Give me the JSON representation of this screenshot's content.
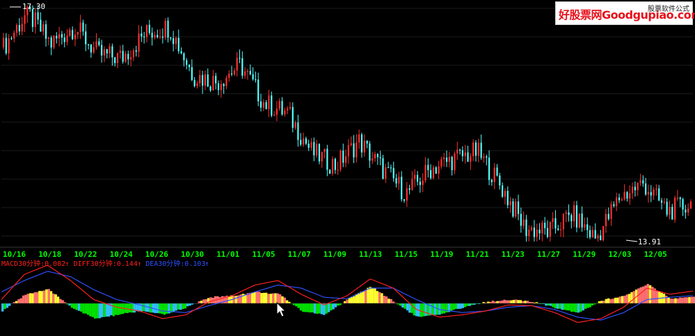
{
  "chart_data": [
    {
      "type": "line",
      "title": "",
      "x": [
        "10/16",
        "10/18",
        "10/22",
        "10/24",
        "10/26",
        "10/30",
        "11/01",
        "11/05",
        "11/07",
        "11/09",
        "11/13",
        "11/15",
        "11/19",
        "11/21",
        "11/23",
        "11/27",
        "11/29",
        "12/03",
        "12/05"
      ],
      "series": [
        {
          "values": [
            16.7,
            17.2,
            16.75,
            17.0,
            16.6,
            16.55,
            16.9,
            17.0,
            16.3,
            16.2,
            16.45,
            15.9,
            15.75,
            15.2,
            15.0,
            15.35,
            14.95,
            14.6,
            14.95,
            15.1,
            15.2,
            14.7,
            14.1,
            14.05,
            14.3,
            13.95,
            14.55,
            14.75,
            14.35,
            14.45
          ]
        }
      ],
      "annotations": {
        "high_label": "17.30",
        "low_label": "13.91"
      },
      "x_tick_color": "#00ff00",
      "colors": {
        "up_bar": "#ff3030",
        "down_bar": "#54ffff",
        "background": "#000000"
      }
    },
    {
      "type": "bar",
      "title": "MACD",
      "legend": [
        {
          "text": "MACD30分钟:0.082",
          "color": "#ff2020"
        },
        {
          "text": "DIFF30分钟:0.144",
          "color": "#ff2020"
        },
        {
          "text": "DEA30分钟:0.103",
          "color": "#3050ff"
        }
      ],
      "series": [
        {
          "name": "DIFF30分钟",
          "color": "#ff2020",
          "values": [
            0.05,
            0.38,
            0.5,
            0.3,
            0.05,
            -0.05,
            -0.1,
            -0.2,
            -0.15,
            0.02,
            0.1,
            0.24,
            0.3,
            0.12,
            -0.02,
            0.1,
            0.32,
            0.2,
            -0.08,
            -0.18,
            -0.15,
            -0.1,
            -0.02,
            -0.03,
            -0.12,
            -0.25,
            -0.2,
            -0.05,
            0.2,
            0.12,
            0.16
          ]
        },
        {
          "name": "DEA30分钟",
          "color": "#3050ff",
          "values": [
            0.15,
            0.3,
            0.42,
            0.35,
            0.18,
            0.05,
            -0.02,
            -0.1,
            -0.12,
            -0.03,
            0.05,
            0.15,
            0.24,
            0.2,
            0.08,
            0.06,
            0.2,
            0.2,
            0.05,
            -0.08,
            -0.12,
            -0.1,
            -0.05,
            -0.03,
            -0.08,
            -0.18,
            -0.22,
            -0.12,
            0.05,
            0.08,
            0.1
          ]
        },
        {
          "name": "MACD30分钟",
          "values": [
            -0.1,
            0.12,
            0.18,
            -0.05,
            -0.2,
            -0.15,
            -0.1,
            -0.15,
            -0.05,
            0.08,
            0.1,
            0.15,
            0.12,
            -0.1,
            -0.15,
            0.06,
            0.22,
            0.02,
            -0.18,
            -0.15,
            -0.05,
            0.02,
            0.05,
            0.02,
            -0.06,
            -0.12,
            0.04,
            0.1,
            0.25,
            0.06,
            0.08
          ]
        }
      ],
      "bar_colors": {
        "positive": [
          "#ffff30",
          "#ff7070"
        ],
        "negative": [
          "#30c0ff",
          "#00e000"
        ]
      }
    }
  ],
  "watermark": {
    "brand": "好股票网Goodgupiao.com",
    "tag": "股票软件公式"
  }
}
